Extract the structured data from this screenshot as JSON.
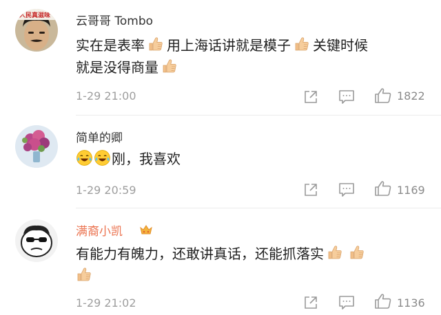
{
  "comments": [
    {
      "username": "云哥哥 Tombo",
      "avatar_badge": "人民真滋味",
      "text_parts": [
        "实在是表率",
        "用上海话讲就是模子",
        "关键时候",
        "就是没得商量"
      ],
      "timestamp": "1-29 21:00",
      "likes": "1822"
    },
    {
      "username": "简单的卿",
      "text": "刚，我喜欢",
      "timestamp": "1-29 20:59",
      "likes": "1169"
    },
    {
      "username": "满裔小凯",
      "badge_icon": "vip-crown-badge",
      "text": "有能力有魄力，还敢讲真话，还能抓落实",
      "timestamp": "1-29 21:02",
      "likes": "1136"
    }
  ],
  "icons": {
    "share": "share-icon",
    "reply": "comment-icon",
    "like": "thumbs-up-icon",
    "emoji_thumb": "thumbs-up-emoji",
    "emoji_laugh": "laugh-cry-emoji"
  },
  "colors": {
    "vip_name": "#eb7350",
    "name": "#333333",
    "text": "#1f1f1f",
    "meta": "#9e9e9e",
    "emoji": "#f3c18a"
  }
}
